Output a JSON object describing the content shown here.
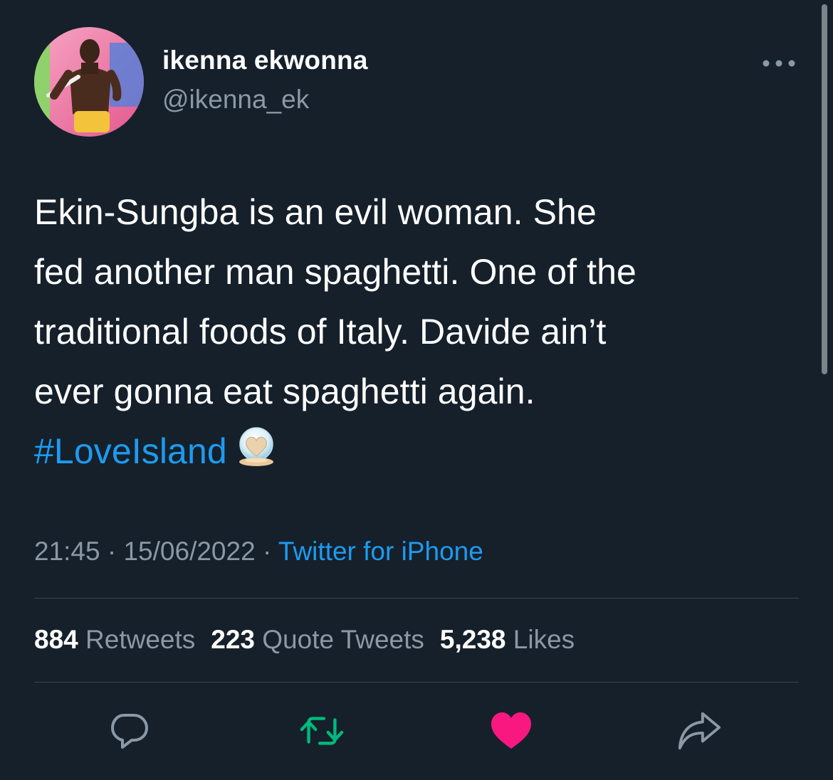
{
  "author": {
    "display_name": "ikenna ekwonna",
    "handle": "@ikenna_ek"
  },
  "tweet": {
    "lines": [
      "Ekin-Sungba is an evil woman. She",
      "fed another man spaghetti. One of the",
      "traditional foods of Italy. Davide ain’t",
      "ever gonna eat spaghetti again."
    ],
    "hashtag": "#LoveIsland",
    "hashtag_emoji": "love-island-heart-icon"
  },
  "meta": {
    "time": "21:45",
    "separator": " · ",
    "date": "15/06/2022",
    "source": "Twitter for iPhone"
  },
  "stats": {
    "retweets_count": "884",
    "retweets_label": "Retweets",
    "quotes_count": "223",
    "quotes_label": "Quote Tweets",
    "likes_count": "5,238",
    "likes_label": "Likes"
  },
  "icons": {
    "more": "more-dots-icon",
    "reply": "reply-bubble-icon",
    "retweet": "retweet-icon",
    "like": "heart-icon",
    "share": "share-icon"
  },
  "colors": {
    "background": "#15202b",
    "link": "#1d9bf0",
    "secondary_text": "#8b98a5",
    "retweet_green": "#00ba7c",
    "like_pink": "#f91880"
  }
}
